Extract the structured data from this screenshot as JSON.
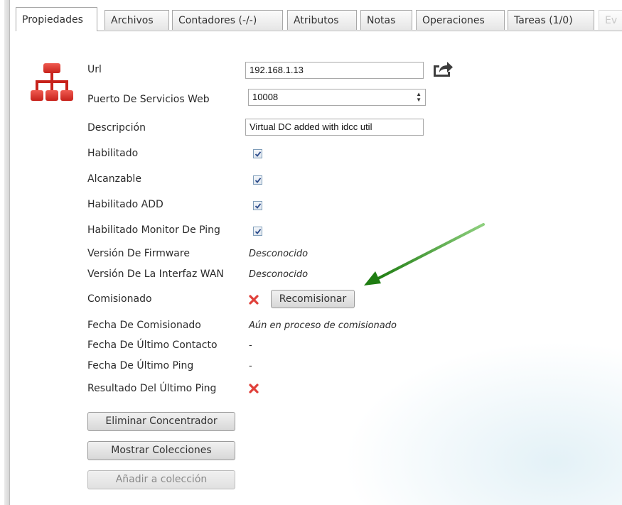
{
  "tabs": [
    {
      "label": "Propiedades",
      "active": true
    },
    {
      "label": "Archivos"
    },
    {
      "label": "Contadores (-/-)"
    },
    {
      "label": "Atributos"
    },
    {
      "label": "Notas"
    },
    {
      "label": "Operaciones"
    },
    {
      "label": "Tareas (1/0)"
    },
    {
      "label": "Ev",
      "faded": true
    }
  ],
  "icons": {
    "device": "network-hub-icon",
    "open_url": "share-external-icon",
    "annotation": "green-arrow"
  },
  "colors": {
    "brand_red": "#d9342b",
    "arrow_green": "#2e8b1e",
    "x_red": "#e0403a"
  },
  "props": {
    "url": {
      "label": "Url",
      "value": "192.168.1.13"
    },
    "port": {
      "label": "Puerto De Servicios Web",
      "value": "10008"
    },
    "description": {
      "label": "Descripción",
      "value": "Virtual DC added with idcc util"
    },
    "enabled": {
      "label": "Habilitado",
      "checked": true
    },
    "reachable": {
      "label": "Alcanzable",
      "checked": true
    },
    "enabled_add": {
      "label": "Habilitado ADD",
      "checked": true
    },
    "ping_monitor": {
      "label": "Habilitado Monitor De Ping",
      "checked": true
    },
    "firmware": {
      "label": "Versión De Firmware",
      "value": "Desconocido"
    },
    "wan": {
      "label": "Versión De La Interfaz WAN",
      "value": "Desconocido"
    },
    "commissioned": {
      "label": "Comisionado",
      "status": "false",
      "button": "Recomisionar"
    },
    "commission_date": {
      "label": "Fecha De Comisionado",
      "value": "Aún en proceso de comisionado"
    },
    "last_contact": {
      "label": "Fecha De Último Contacto",
      "value": "-"
    },
    "last_ping": {
      "label": "Fecha De Último Ping",
      "value": "-"
    },
    "last_ping_result": {
      "label": "Resultado Del Último Ping",
      "status": "false"
    }
  },
  "actions": {
    "delete": "Eliminar Concentrador",
    "show_collections": "Mostrar Colecciones",
    "add_to_collection": "Añadir a colección"
  }
}
